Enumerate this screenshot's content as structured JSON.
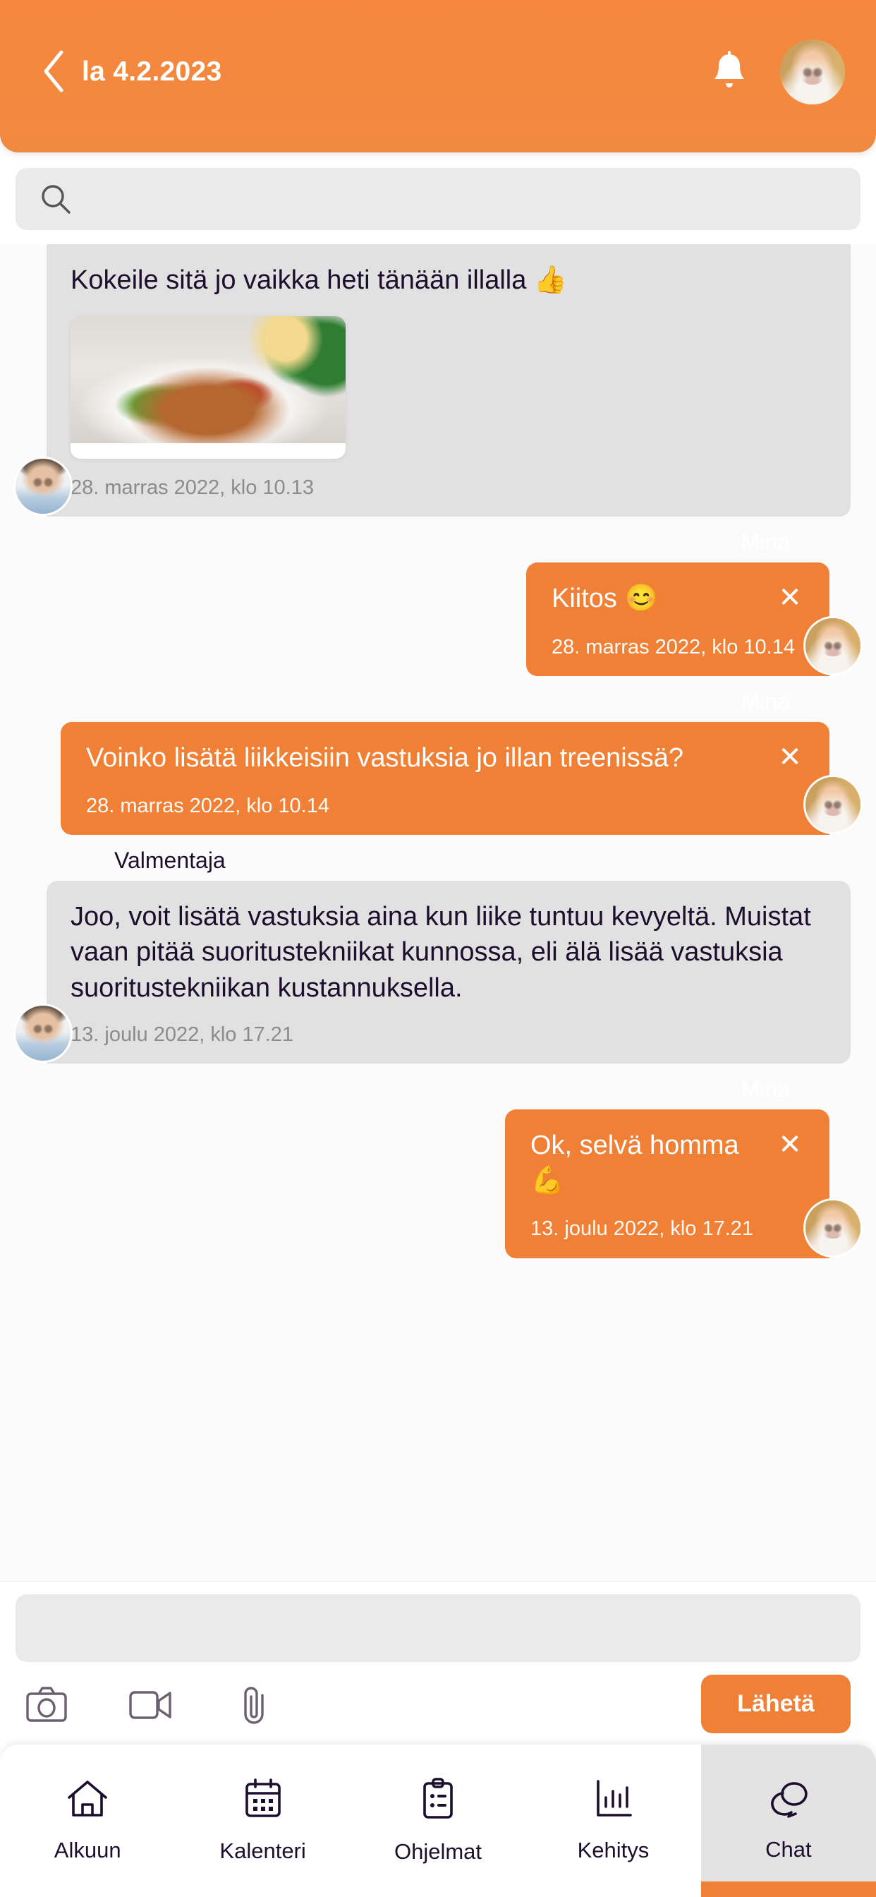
{
  "header": {
    "title": "la 4.2.2023",
    "back_icon": "chevron-left-icon",
    "bell_icon": "bell-icon",
    "avatar_alt": "user-avatar"
  },
  "search": {
    "value": "",
    "placeholder": "",
    "icon": "search-icon"
  },
  "messages": [
    {
      "side": "in",
      "sender": "",
      "text": "Kokeile sitä jo vaikka heti tänään illalla 👍",
      "timestamp": "28. marras 2022, klo 10.13",
      "has_photo": true,
      "avatar": "coach"
    },
    {
      "side": "out",
      "sender": "Minä",
      "text": "Kiitos 😊",
      "timestamp": "28. marras 2022, klo 10.14",
      "close_label": "✕",
      "avatar": "me"
    },
    {
      "side": "out",
      "sender": "Minä",
      "text": "Voinko lisätä liikkeisiin vastuksia jo illan treenissä?",
      "timestamp": "28. marras 2022, klo 10.14",
      "close_label": "✕",
      "avatar": "me"
    },
    {
      "side": "in",
      "sender": "Valmentaja",
      "text": "Joo, voit lisätä vastuksia aina kun liike tuntuu kevyeltä. Muistat vaan pitää suoritustekniikat kunnossa, eli älä lisää vastuksia suoritustekniikan kustannuksella.",
      "timestamp": "13. joulu 2022, klo 17.21",
      "has_photo": false,
      "avatar": "coach"
    },
    {
      "side": "out",
      "sender": "Minä",
      "text": "Ok, selvä homma 💪",
      "timestamp": "13. joulu 2022, klo 17.21",
      "close_label": "✕",
      "avatar": "me"
    }
  ],
  "composer": {
    "value": "",
    "placeholder": "",
    "camera_icon": "camera-icon",
    "video_icon": "video-camera-icon",
    "attach_icon": "paperclip-icon",
    "send_label": "Lähetä"
  },
  "tabbar": {
    "items": [
      {
        "label": "Alkuun",
        "icon": "home-icon",
        "active": false
      },
      {
        "label": "Kalenteri",
        "icon": "calendar-icon",
        "active": false
      },
      {
        "label": "Ohjelmat",
        "icon": "clipboard-icon",
        "active": false
      },
      {
        "label": "Kehitys",
        "icon": "bar-chart-icon",
        "active": false
      },
      {
        "label": "Chat",
        "icon": "chat-icon",
        "active": true
      }
    ]
  },
  "colors": {
    "accent": "#ef8036",
    "header": "#f4873c",
    "bubble_in": "#e1e1e1",
    "text": "#1c0f2e"
  }
}
